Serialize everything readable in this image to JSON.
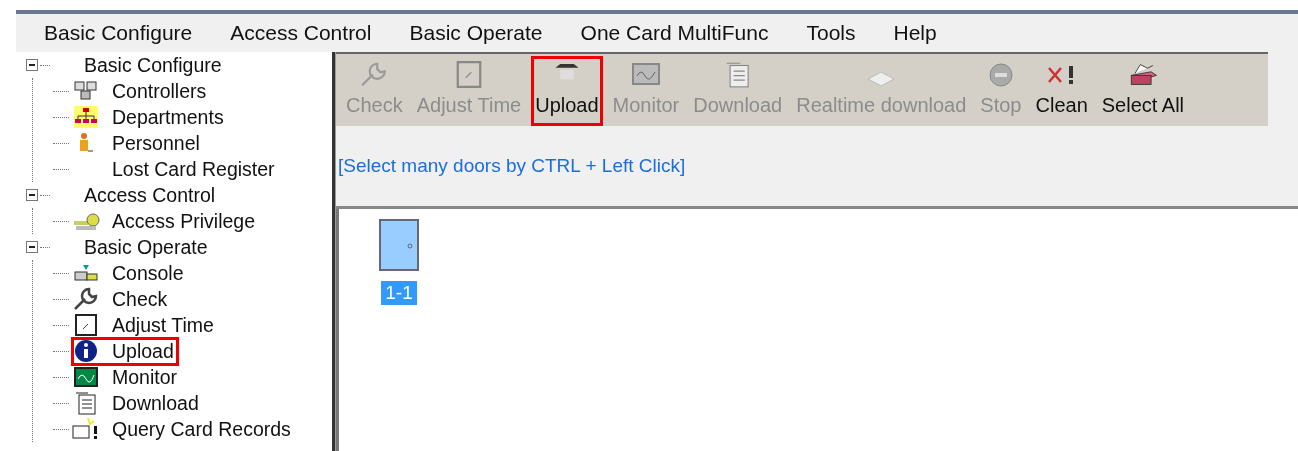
{
  "menu": [
    {
      "label": "Basic Configure"
    },
    {
      "label": "Access Control"
    },
    {
      "label": "Basic Operate"
    },
    {
      "label": "One Card MultiFunc"
    },
    {
      "label": "Tools"
    },
    {
      "label": "Help"
    }
  ],
  "tree": [
    {
      "label": "Basic Configure",
      "expanded": true,
      "children": [
        {
          "label": "Controllers",
          "kind": "controllers",
          "highlighted": false
        },
        {
          "label": "Departments",
          "kind": "departments",
          "highlighted": false
        },
        {
          "label": "Personnel",
          "kind": "personnel",
          "highlighted": false
        },
        {
          "label": "Lost Card Register",
          "kind": "none",
          "highlighted": false
        }
      ]
    },
    {
      "label": "Access Control",
      "expanded": true,
      "children": [
        {
          "label": "Access Privilege",
          "kind": "key",
          "highlighted": false
        }
      ]
    },
    {
      "label": "Basic Operate",
      "expanded": true,
      "children": [
        {
          "label": "Console",
          "kind": "console",
          "highlighted": false
        },
        {
          "label": "Check",
          "kind": "wrench",
          "highlighted": false
        },
        {
          "label": "Adjust Time",
          "kind": "clock",
          "highlighted": false
        },
        {
          "label": "Upload",
          "kind": "info",
          "highlighted": true
        },
        {
          "label": "Monitor",
          "kind": "monitor",
          "highlighted": false
        },
        {
          "label": "Download",
          "kind": "download",
          "highlighted": false
        },
        {
          "label": "Query Card Records",
          "kind": "query",
          "highlighted": false
        }
      ]
    }
  ],
  "toolbar": [
    {
      "label": "Check",
      "kind": "wrench",
      "disabled": true,
      "highlighted": false
    },
    {
      "label": "Adjust Time",
      "kind": "clock",
      "disabled": true,
      "highlighted": false
    },
    {
      "label": "Upload",
      "kind": "upload",
      "disabled": false,
      "highlighted": true
    },
    {
      "label": "Monitor",
      "kind": "monitor",
      "disabled": true,
      "highlighted": false
    },
    {
      "label": "Download",
      "kind": "download",
      "disabled": true,
      "highlighted": false
    },
    {
      "label": "Realtime download",
      "kind": "realtime",
      "disabled": true,
      "highlighted": false
    },
    {
      "label": "Stop",
      "kind": "stop",
      "disabled": true,
      "highlighted": false
    },
    {
      "label": "Clean",
      "kind": "clean",
      "disabled": false,
      "highlighted": false
    },
    {
      "label": "Select All",
      "kind": "selectall",
      "disabled": false,
      "highlighted": false
    }
  ],
  "hint": "[Select many doors by CTRL + Left Click]",
  "doors": [
    {
      "label": "1-1",
      "selected": true
    }
  ]
}
